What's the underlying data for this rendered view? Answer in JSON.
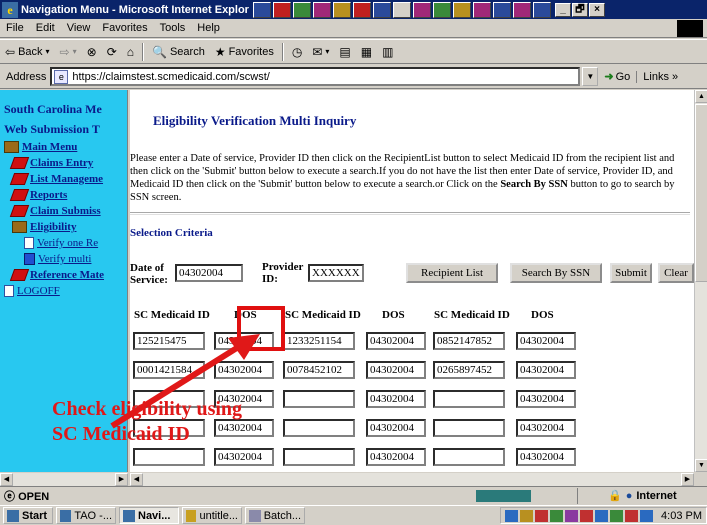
{
  "window": {
    "title": "Navigation Menu - Microsoft Internet Explorer provided by BC",
    "controls": [
      "_",
      "🗗",
      "×"
    ]
  },
  "menubar": [
    "File",
    "Edit",
    "View",
    "Favorites",
    "Tools",
    "Help"
  ],
  "toolbar": {
    "back_label": "Back",
    "search_label": "Search",
    "favorites_label": "Favorites"
  },
  "address": {
    "label": "Address",
    "url": "https://claimstest.scmedicaid.com/scwst/",
    "go_label": "Go",
    "links_label": "Links"
  },
  "sidebar": {
    "title_line1": "South Carolina Me",
    "title_line2": "Web Submission T",
    "items": [
      {
        "label": "Main Menu",
        "icon": "book-icon"
      },
      {
        "label": "Claims Entry",
        "icon": "diamond-icon"
      },
      {
        "label": "List Manageme",
        "icon": "diamond-icon"
      },
      {
        "label": "Reports",
        "icon": "diamond-icon"
      },
      {
        "label": "Claim Submiss",
        "icon": "diamond-icon"
      },
      {
        "label": "Eligibility",
        "icon": "book-icon"
      },
      {
        "label": "Verify one Re",
        "icon": "document-icon"
      },
      {
        "label": "Verify multi",
        "icon": "cube-icon"
      },
      {
        "label": "Reference Mate",
        "icon": "diamond-icon"
      },
      {
        "label": "LOGOFF",
        "icon": "document-icon"
      }
    ]
  },
  "main": {
    "title": "Eligibility Verification Multi Inquiry",
    "instructions": {
      "part1": "Please enter a Date of  service, Provider ID then click on the RecipientList button to select Medicaid ID from the recipient list and then click on the 'Submit' button below to execute a search.If you do not have the list then enter Date of  service, Provider ID, and Medicaid ID then click on the 'Submit' button below to execute a search.or Click on the ",
      "bold": "Search By SSN",
      "part2": " button to go to search by  SSN screen."
    },
    "selection_criteria": "Selection Criteria",
    "form": {
      "dos_label_1": "Date of",
      "dos_label_2": "Service:",
      "dos_value": "04302004",
      "provider_label_1": "Provider",
      "provider_label_2": "ID:",
      "provider_value": "XXXXXX"
    },
    "buttons": {
      "recipient_list": "Recipient List",
      "search_ssn": "Search By SSN",
      "submit": "Submit",
      "clear": "Clear"
    },
    "columns": [
      "SC Medicaid ID",
      "DOS",
      "SC Medicaid ID",
      "DOS",
      "SC Medicaid ID",
      "DOS"
    ],
    "rows": [
      [
        "125215475",
        "04302004",
        "1233251154",
        "04302004",
        "0852147852",
        "04302004"
      ],
      [
        "0001421584",
        "04302004",
        "0078452102",
        "04302004",
        "0265897452",
        "04302004"
      ],
      [
        "",
        "04302004",
        "",
        "04302004",
        "",
        "04302004"
      ],
      [
        "",
        "04302004",
        "",
        "04302004",
        "",
        "04302004"
      ],
      [
        "",
        "04302004",
        "",
        "04302004",
        "",
        "04302004"
      ]
    ]
  },
  "annotation": {
    "line1": "Check eligibility using",
    "line2": "SC Medicaid ID",
    "color": "#e01818"
  },
  "statusbar": {
    "text": "OPEN",
    "zone": "Internet"
  },
  "taskbar": {
    "start": "Start",
    "buttons": [
      "TAO -...",
      "Navi...",
      "untitle...",
      "Batch..."
    ],
    "active_index": 1,
    "clock": "4:03 PM"
  }
}
